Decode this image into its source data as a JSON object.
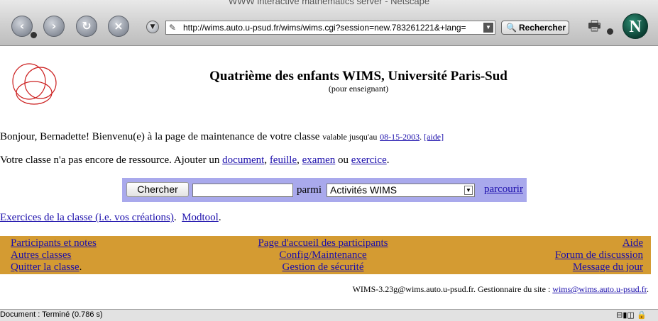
{
  "browser": {
    "window_title": "WWW interactive mathematics server - Netscape",
    "url": "http://wims.auto.u-psud.fr/wims/wims.cgi?session=new.783261221&+lang=",
    "search_button": "Rechercher",
    "status": "Document : Terminé (0.786 s)",
    "icons": [
      "back-icon",
      "forward-icon",
      "reload-icon",
      "stop-icon",
      "history-icon",
      "page-icon",
      "search-icon",
      "print-icon",
      "netscape-logo"
    ]
  },
  "page": {
    "title": "Quatrième des enfants WIMS, Université Paris-Sud",
    "subtitle": "(pour enseignant)",
    "greeting": {
      "text": "Bonjour, Bernadette! Bienvenu(e) à la page de maintenance de votre classe",
      "valid_prefix": "valable jusqu'au",
      "date": "08-15-2003",
      "period": ".",
      "help": "[aide]"
    },
    "resources": {
      "text": "Votre classe n'a pas encore de ressource. Ajouter un",
      "document": "document",
      "sep1": ",",
      "feuille": "feuille",
      "sep2": ",",
      "examen": "examen",
      "ou": "ou",
      "exercice": "exercice",
      "end": "."
    },
    "search": {
      "button": "Chercher",
      "query": "",
      "parmi": "parmi",
      "select_value": "Activités WIMS",
      "browse": "parcourir",
      "bg_color": "#a9a9ec"
    },
    "exercise_links": {
      "class_exercises": "Exercices de la classe (i.e. vos créations)",
      "period": ".",
      "modtool": "Modtool",
      "end": "."
    },
    "menu": {
      "bg_color": "#d49b32",
      "left": [
        "Participants et notes",
        "Autres classes",
        "Quitter la classe"
      ],
      "left_end": ".",
      "middle": [
        "Page d'accueil des participants",
        "Config/Maintenance",
        "Gestion de sécurité"
      ],
      "right": [
        "Aide",
        "Forum de discussion",
        "Message du jour"
      ]
    },
    "footer": {
      "text": "WIMS-3.23g@wims.auto.u-psud.fr. Gestionnaire du site :",
      "email": "wims@wims.auto.u-psud.fr",
      "end": "."
    }
  }
}
